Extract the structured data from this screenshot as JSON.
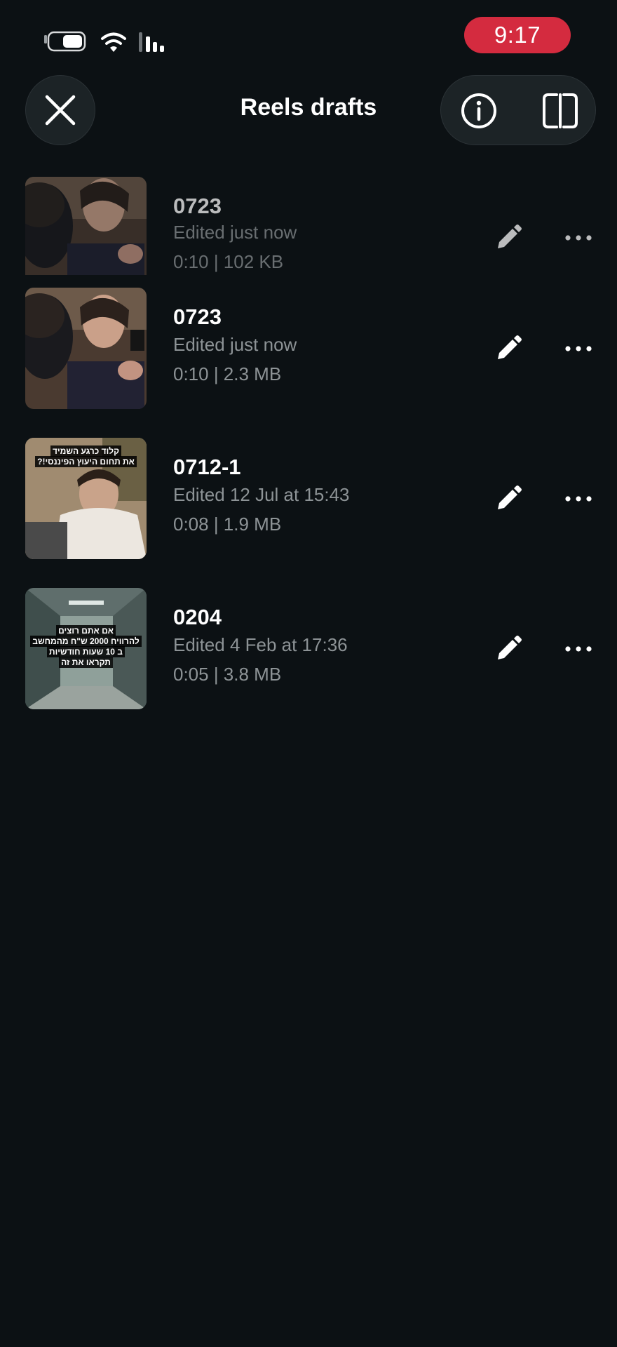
{
  "status_bar": {
    "time": "9:17",
    "time_color": "#d42b3f",
    "icons": [
      "battery-icon",
      "wifi-icon",
      "signal-icon"
    ]
  },
  "header": {
    "title": "Reels drafts",
    "close_icon": "close-icon",
    "info_icon": "info-icon",
    "panel_icon": "panel-toggle-icon"
  },
  "drafts": [
    {
      "name": "0723",
      "edited": "Edited just now",
      "meta": "0:10 | 102 KB",
      "dimmed": true,
      "thumb_caption": []
    },
    {
      "name": "0723",
      "edited": "Edited just now",
      "meta": "0:10 | 2.3 MB",
      "dimmed": false,
      "thumb_caption": []
    },
    {
      "name": "0712-1",
      "edited": "Edited 12 Jul at 15:43",
      "meta": "0:08 | 1.9 MB",
      "dimmed": false,
      "thumb_caption": [
        "קלוד כרגע השמיד",
        "את תחום היעוץ הפיננסי!?"
      ]
    },
    {
      "name": "0204",
      "edited": "Edited 4 Feb at 17:36",
      "meta": "0:05 | 3.8 MB",
      "dimmed": false,
      "thumb_caption": [
        "אם אתם רוצים",
        "להרוויח 2000 ש\"ח מהמחשב",
        "ב 10 שעות חודשיות",
        "תקראו את זה"
      ]
    }
  ],
  "row_icons": {
    "edit_icon": "pencil-icon",
    "more_icon": "more-dots-icon"
  }
}
